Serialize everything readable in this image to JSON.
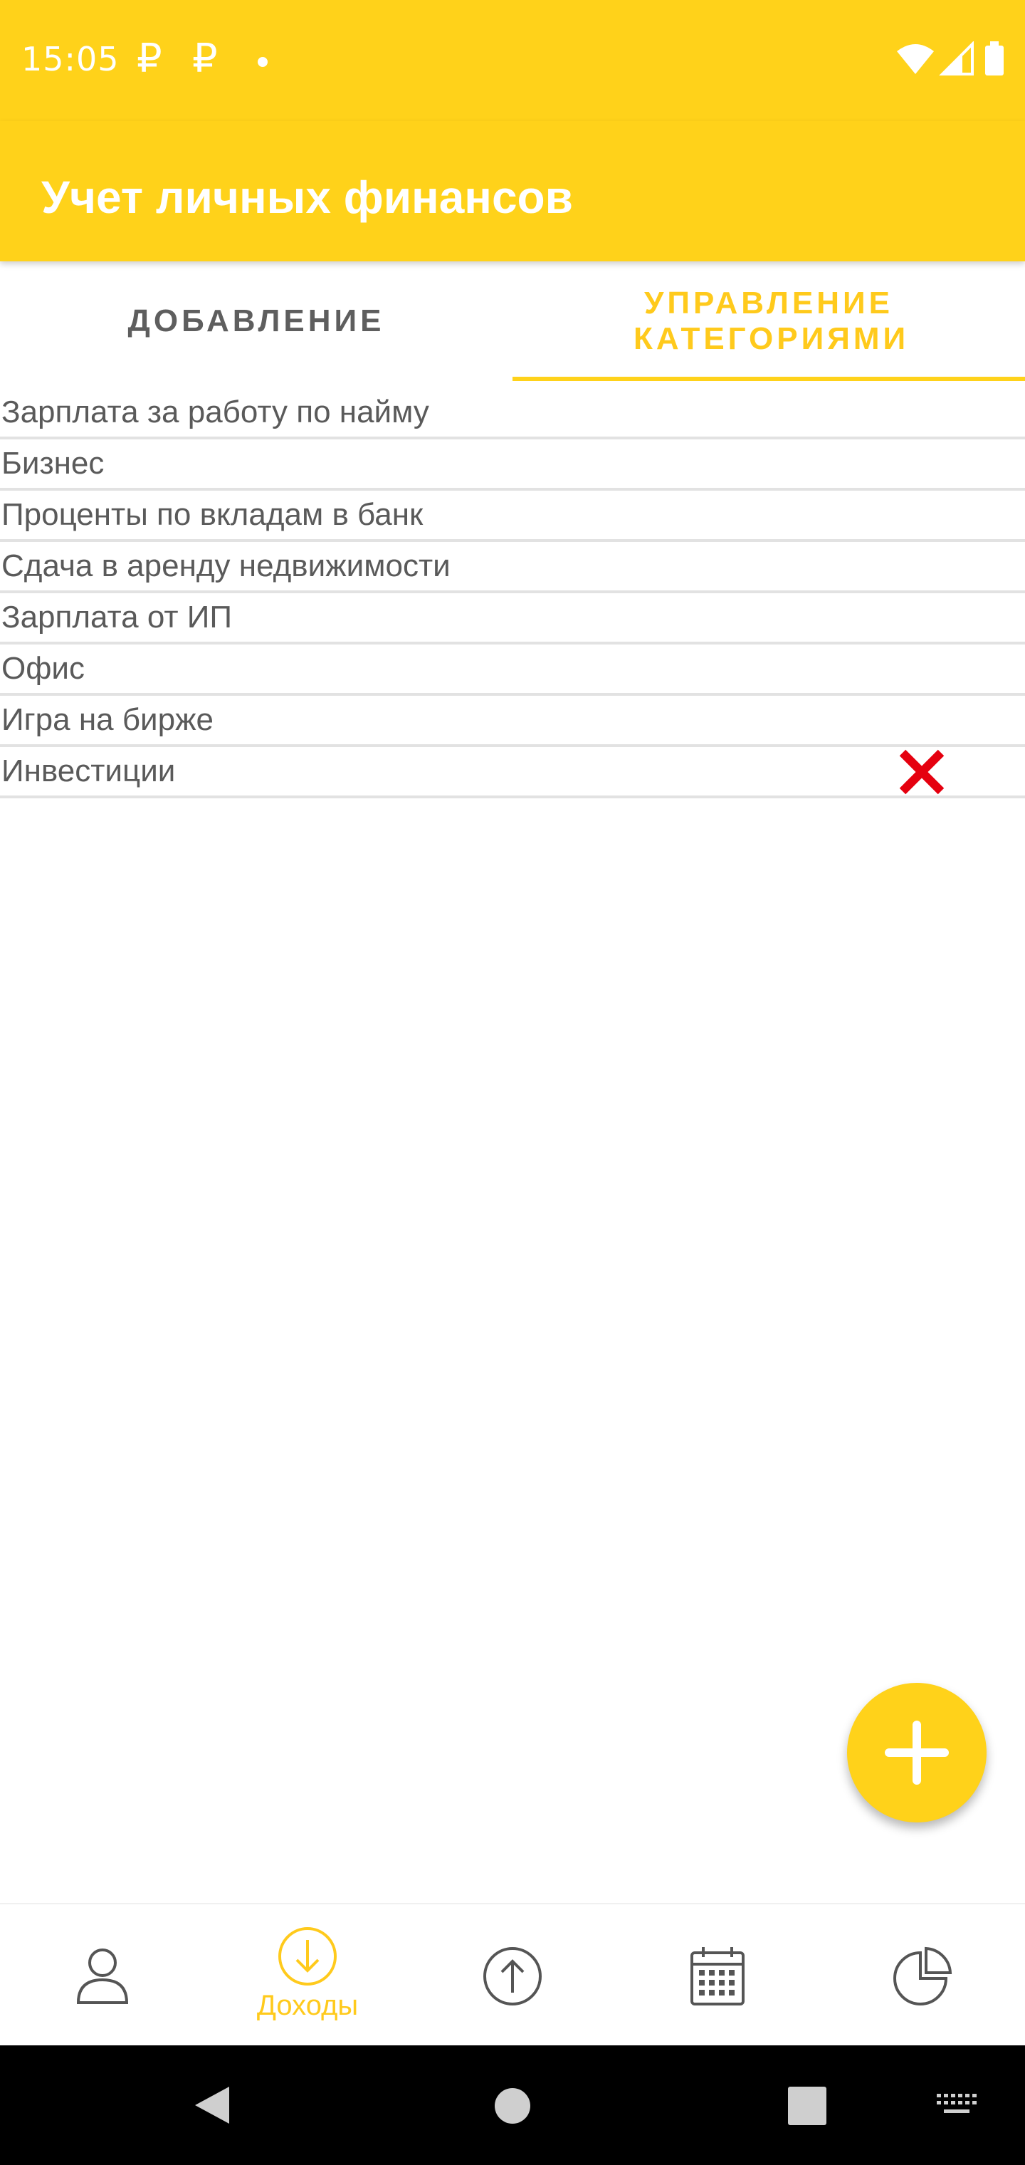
{
  "status_bar": {
    "time": "15:05",
    "notification_icons": [
      "₽",
      "₽"
    ]
  },
  "app_bar": {
    "title": "Учет личных финансов"
  },
  "tabs": [
    {
      "label": "ДОБАВЛЕНИЕ",
      "active": false
    },
    {
      "label": "УПРАВЛЕНИЕ КАТЕГОРИЯМИ",
      "active": true
    }
  ],
  "categories": [
    {
      "name": "Зарплата за работу по найму"
    },
    {
      "name": "Бизнес"
    },
    {
      "name": "Проценты по вкладам в банк"
    },
    {
      "name": "Сдача в аренду недвижимости"
    },
    {
      "name": "Зарплата от ИП"
    },
    {
      "name": "Офис"
    },
    {
      "name": "Игра на бирже"
    },
    {
      "name": "Инвестиции",
      "delete_icon": "close-icon"
    }
  ],
  "bottom_nav": [
    {
      "icon": "person-icon",
      "label": ""
    },
    {
      "icon": "arrow-down-circle-icon",
      "label": "Доходы",
      "active": true
    },
    {
      "icon": "arrow-up-circle-icon",
      "label": ""
    },
    {
      "icon": "calendar-icon",
      "label": ""
    },
    {
      "icon": "pie-chart-icon",
      "label": ""
    }
  ],
  "colors": {
    "accent": "#FFD21A",
    "active_text": "#FFCA1C",
    "delete": "#E5000F"
  }
}
